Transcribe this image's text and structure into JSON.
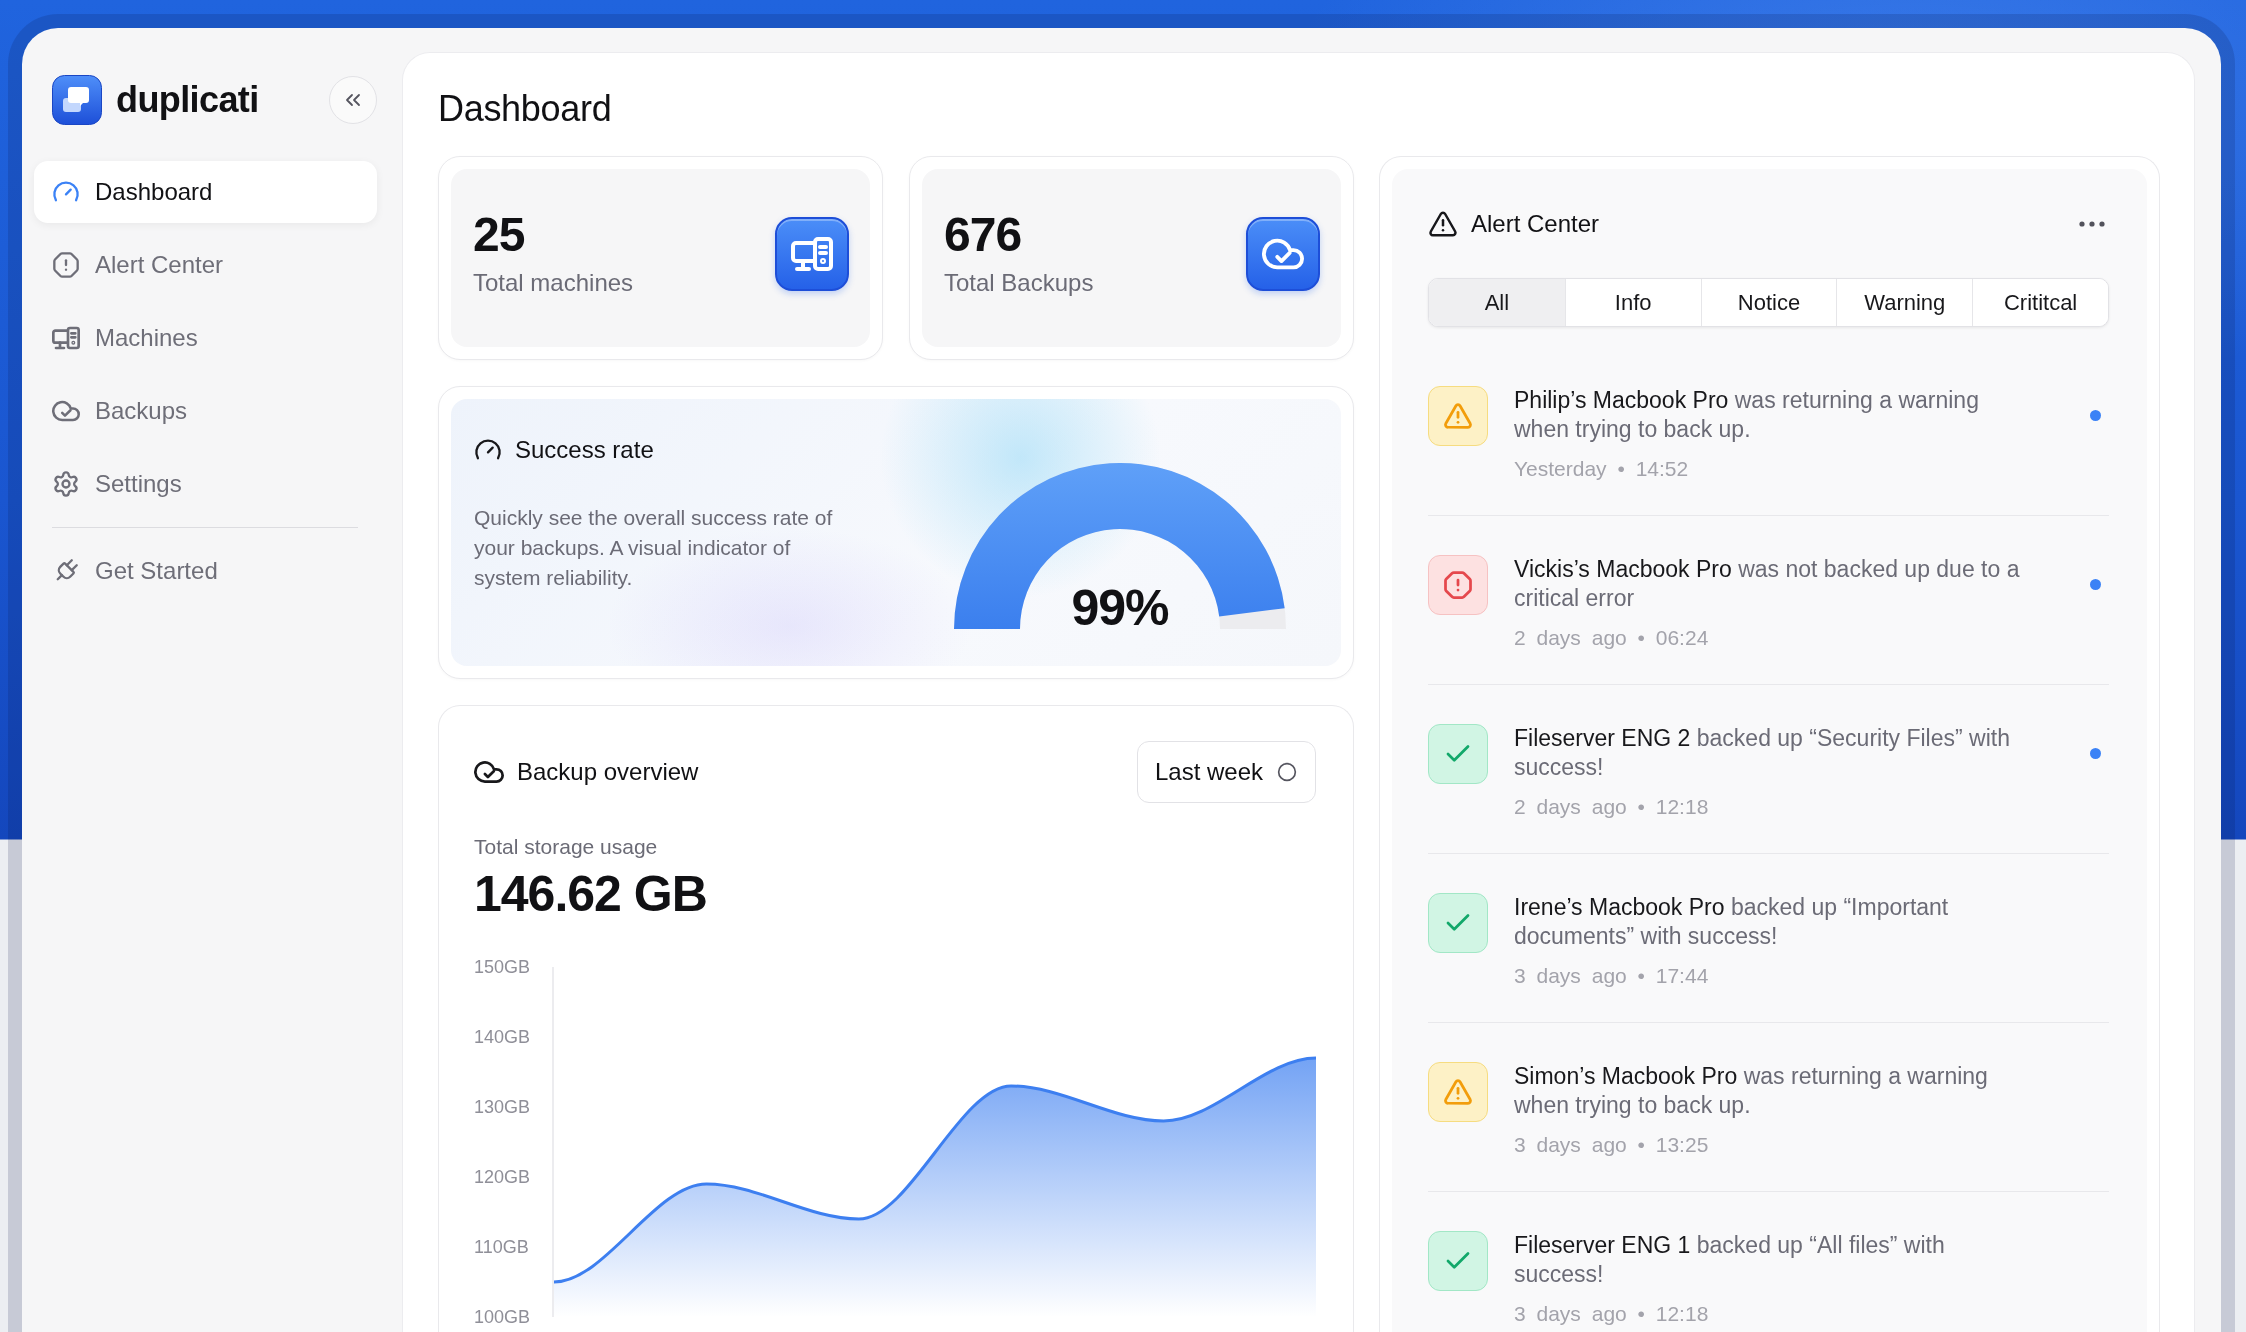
{
  "sidebar": {
    "app_name": "duplicati",
    "items": [
      {
        "label": "Dashboard",
        "selected": true
      },
      {
        "label": "Alert Center",
        "selected": false
      },
      {
        "label": "Machines",
        "selected": false
      },
      {
        "label": "Backups",
        "selected": false
      },
      {
        "label": "Settings",
        "selected": false
      }
    ],
    "footer_items": [
      {
        "label": "Get Started",
        "selected": false
      }
    ]
  },
  "page_title": "Dashboard",
  "stats": [
    {
      "value": "25",
      "label": "Total machines"
    },
    {
      "value": "676",
      "label": "Total Backups"
    }
  ],
  "success_rate": {
    "title": "Success rate",
    "description": "Quickly see the overall success rate of your backups. A visual indicator of system reliability.",
    "value": "99%",
    "level": 0.96
  },
  "backup_overview": {
    "title": "Backup overview",
    "period": "Last week",
    "storage_label": "Total storage usage",
    "storage_value": "146.62 GB",
    "chart_data": {
      "type": "area",
      "categories": [
        null,
        null,
        null,
        null,
        null,
        null
      ],
      "ylim": [
        100,
        150
      ],
      "yticks": [
        {
          "value": 150,
          "label": "150GB"
        },
        {
          "value": 140,
          "label": "140GB"
        },
        {
          "value": 130,
          "label": "130GB"
        },
        {
          "value": 120,
          "label": "120GB"
        },
        {
          "value": 110,
          "label": "110GB"
        },
        {
          "value": 100,
          "label": "100GB"
        }
      ],
      "series": [
        {
          "color": "#3d7ff0",
          "values": [
            105,
            119,
            114,
            133,
            128,
            137
          ]
        }
      ]
    }
  },
  "alert_center": {
    "title": "Alert Center",
    "filters": [
      {
        "label": "All",
        "selected": true
      },
      {
        "label": "Info",
        "selected": false
      },
      {
        "label": "Notice",
        "selected": false
      },
      {
        "label": "Warning",
        "selected": false
      },
      {
        "label": "Crititcal",
        "selected": false
      }
    ],
    "alerts": [
      {
        "kind": "warning",
        "name": "Philip’s Macbook Pro",
        "message": "was returning a warning when trying to back up.",
        "time": "Yesterday • 14:52",
        "unread": true
      },
      {
        "kind": "critical",
        "name": "Vickis’s Macbook Pro",
        "message": "was not backed up due to a critical error",
        "time": "2 days ago • 06:24",
        "unread": true
      },
      {
        "kind": "success",
        "name": "Fileserver ENG 2",
        "message": "backed up “Security Files” with success!",
        "time": "2 days ago • 12:18",
        "unread": true
      },
      {
        "kind": "success",
        "name": "Irene’s Macbook Pro",
        "message": "backed up “Important documents” with success!",
        "time": "3 days ago • 17:44",
        "unread": false
      },
      {
        "kind": "warning",
        "name": "Simon’s Macbook Pro",
        "message": "was returning a warning when trying to back up.",
        "time": "3 days ago • 13:25",
        "unread": false
      },
      {
        "kind": "success",
        "name": "Fileserver ENG 1",
        "message": "backed up “All files” with success!",
        "time": "3 days ago • 12:18",
        "unread": false
      }
    ]
  }
}
